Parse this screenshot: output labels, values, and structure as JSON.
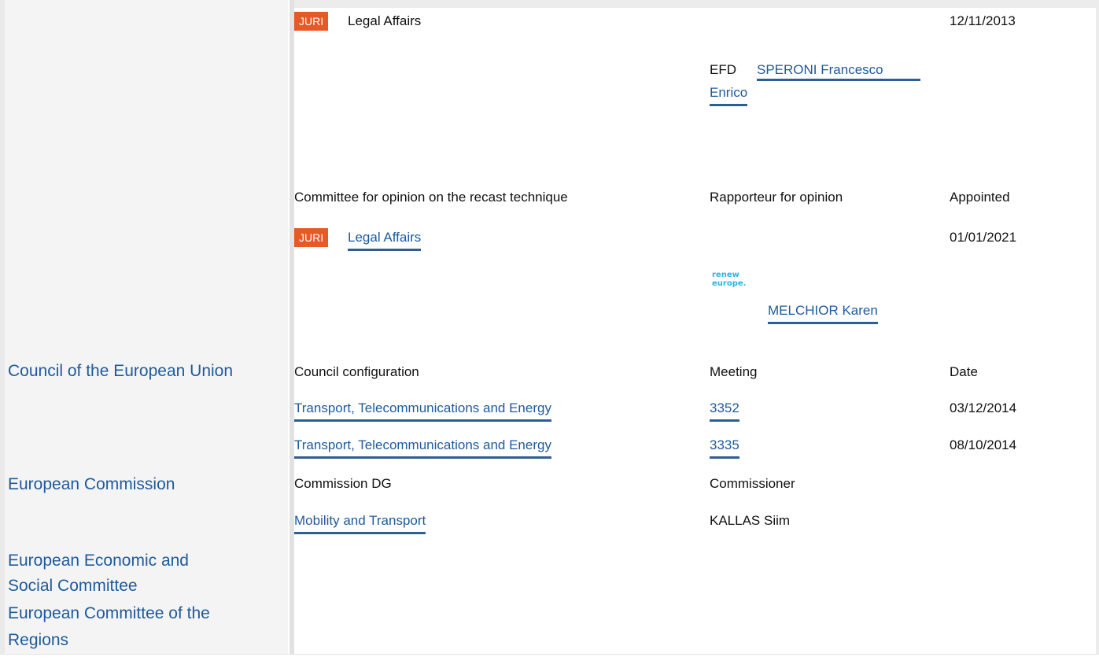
{
  "rapporteur_block": {
    "committee_badge": "JURI",
    "committee_name": "Legal Affairs",
    "appointed_date": "12/11/2013",
    "group": "EFD",
    "rapporteur_line1": "SPERONI Francesco",
    "rapporteur_line2": "Enrico"
  },
  "opinion_block": {
    "headers": {
      "committee": "Committee for opinion on the recast technique",
      "rapporteur": "Rapporteur for opinion",
      "appointed": "Appointed"
    },
    "committee_badge": "JURI",
    "committee_name": "Legal Affairs",
    "appointed_date": "01/01/2021",
    "group_logo_line1": "renew",
    "group_logo_line2": "europe.",
    "rapporteur": "MELCHIOR Karen"
  },
  "council": {
    "institution": "Council of the European Union",
    "headers": {
      "configuration": "Council configuration",
      "meeting": "Meeting",
      "date": "Date"
    },
    "rows": [
      {
        "configuration": "Transport, Telecommunications and Energy",
        "meeting": "3352",
        "date": "03/12/2014"
      },
      {
        "configuration": "Transport, Telecommunications and Energy",
        "meeting": "3335",
        "date": "08/10/2014"
      }
    ]
  },
  "commission": {
    "institution": "European Commission",
    "headers": {
      "dg": "Commission DG",
      "commissioner": "Commissioner"
    },
    "dg": "Mobility and Transport",
    "commissioner": "KALLAS Siim"
  },
  "eesc": {
    "line1": "European Economic and",
    "line2": "Social Committee"
  },
  "cor": {
    "line1": "European Committee of the",
    "line2": "Regions"
  },
  "colors": {
    "link": "#1e5a9c",
    "badge": "#e65a27",
    "sidebar": "#f4f4f4"
  }
}
